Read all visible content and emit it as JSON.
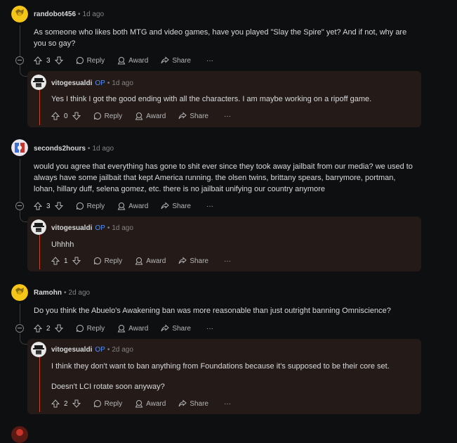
{
  "comments": [
    {
      "author": "randobot456",
      "time": "1d ago",
      "body": "As someone who likes both MTG and video games, have you played \"Slay the Spire\" yet? And if not, why are you so gay?",
      "votes": "3",
      "reply_label": "Reply",
      "award_label": "Award",
      "share_label": "Share",
      "more_label": "···",
      "reply": {
        "author": "vitogesualdi",
        "op": "OP",
        "time": "1d ago",
        "body": "Yes I think I got the good ending with all the characters. I am maybe working on a ripoff game.",
        "votes": "0"
      }
    },
    {
      "author": "seconds2hours",
      "time": "1d ago",
      "body": "would you agree that everything has gone to shit ever since they took away jailbait from our media? we used to always have some jailbait that kept America running. the olsen twins, brittany spears, barrymore, portman, lohan, hillary duff, selena gomez, etc. there is no jailbait unifying our country anymore",
      "votes": "3",
      "reply": {
        "author": "vitogesualdi",
        "op": "OP",
        "time": "1d ago",
        "body": "Uhhhh",
        "votes": "1"
      }
    },
    {
      "author": "Ramohn",
      "time": "2d ago",
      "body": "Do you think the Abuelo's Awakening ban was more reasonable than just outright banning Omniscience?",
      "votes": "2",
      "reply": {
        "author": "vitogesualdi",
        "op": "OP",
        "time": "2d ago",
        "body": "I think they don't want to ban anything from Foundations because it's supposed to be their core set.",
        "body2": "Doesn't LCI rotate soon anyway?",
        "votes": "2"
      }
    }
  ],
  "labels": {
    "reply": "Reply",
    "award": "Award",
    "share": "Share",
    "more": "···",
    "dot": "•"
  },
  "colors": {
    "background": "#0e0f10",
    "reply_background": "#241a17",
    "op": "#4f8ff7",
    "accent_line": "#c8442a",
    "avatar_yellow": "#f5c518"
  }
}
